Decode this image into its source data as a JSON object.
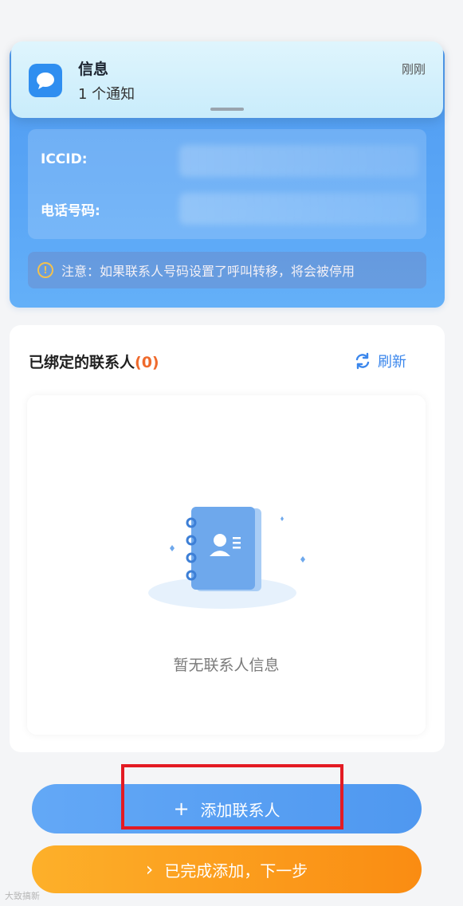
{
  "notification": {
    "app": "信息",
    "summary": "1 个通知",
    "time": "刚刚"
  },
  "sim": {
    "iccid_label": "ICCID:",
    "phone_label": "电话号码:",
    "notice": "注意：如果联系人号码设置了呼叫转移，将会被停用"
  },
  "contacts": {
    "title": "已绑定的联系人",
    "count": "(0)",
    "refresh_label": "刷新",
    "empty_text": "暂无联系人信息"
  },
  "actions": {
    "add_label": "添加联系人",
    "add_glyph": "+",
    "next_label": "已完成添加，下一步",
    "next_glyph": "›"
  },
  "watermark": "大致搞新",
  "colors": {
    "primary_blue": "#4f98f0",
    "accent_orange": "#fa8c12",
    "count_orange": "#ef6a2c",
    "highlight_red": "#e31b23"
  }
}
